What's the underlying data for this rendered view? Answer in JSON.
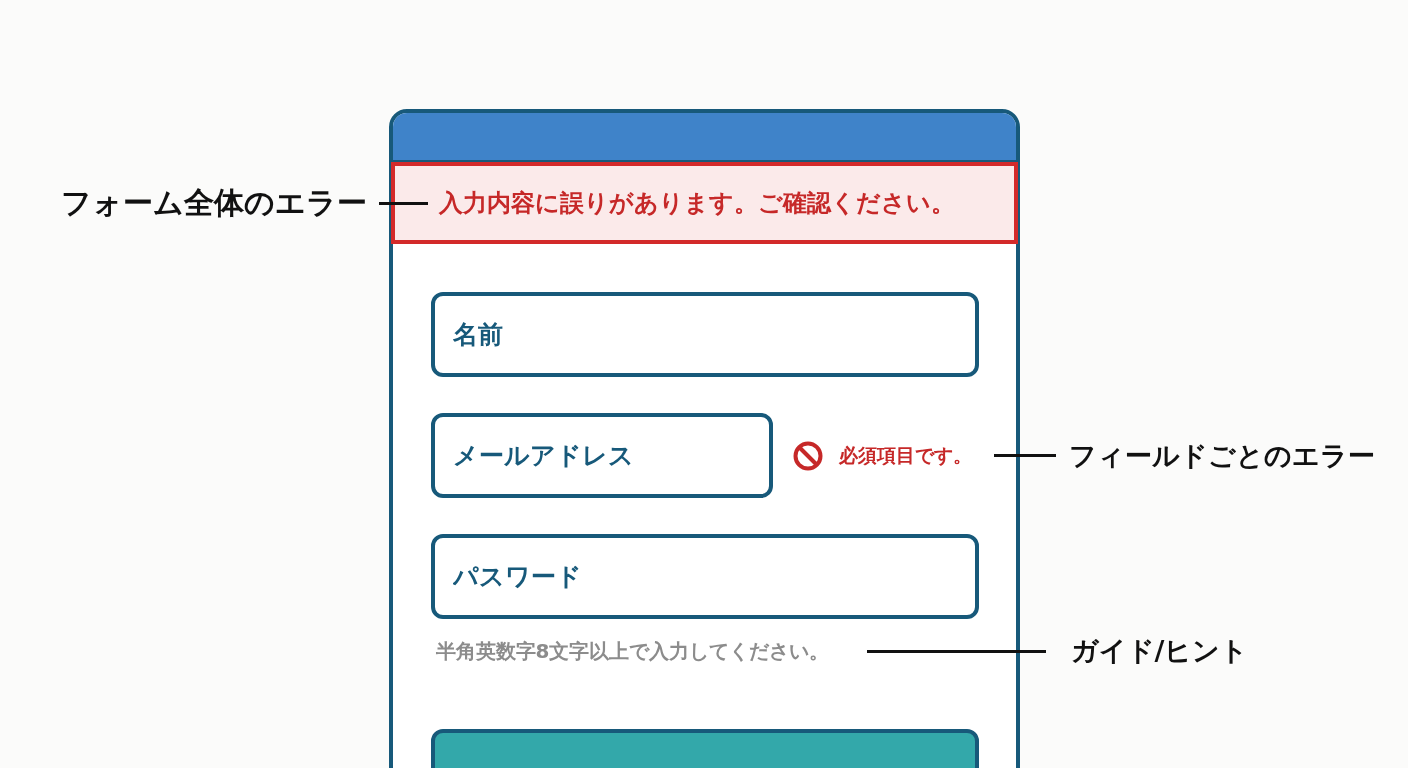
{
  "form": {
    "error_banner": {
      "message": "入力内容に誤りがあります。ご確認ください。",
      "annotation": "フォーム全体のエラー"
    },
    "fields": [
      {
        "placeholder": "名前"
      },
      {
        "placeholder": "メールアドレス",
        "error": "必須項目です。",
        "annotation": "フィールドごとのエラー"
      },
      {
        "placeholder": "パスワード",
        "hint": "半角英数字8文字以上で入力してください。",
        "hint_annotation": "ガイド/ヒント"
      }
    ]
  }
}
